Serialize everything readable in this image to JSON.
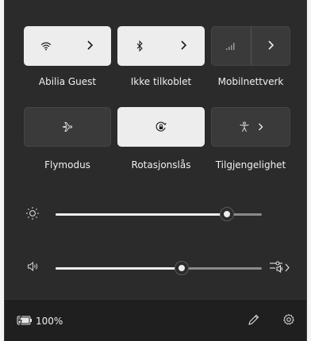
{
  "tiles": {
    "wifi": {
      "label": "Abilia Guest"
    },
    "bluetooth": {
      "label": "Ikke tilkoblet"
    },
    "mobile": {
      "label": "Mobilnettverk"
    },
    "airplane": {
      "label": "Flymodus"
    },
    "rotation": {
      "label": "Rotasjonslås"
    },
    "accessibility": {
      "label": "Tilgjengelighet"
    }
  },
  "sliders": {
    "brightness": {
      "level_percent": 83
    },
    "volume": {
      "level_percent": 61
    }
  },
  "footer": {
    "battery": "100%"
  },
  "colors": {
    "panel": "#2b2b2b",
    "tile_on": "#ededed",
    "tile_off": "#3a3a3a",
    "footer": "#1f1f1f"
  }
}
